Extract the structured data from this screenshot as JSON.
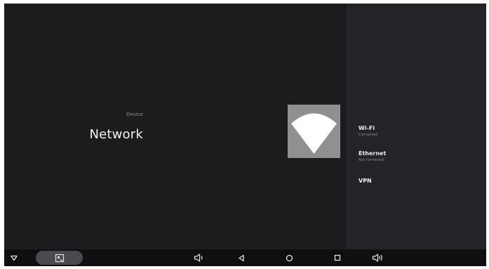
{
  "header": {
    "breadcrumb": "Device",
    "title": "Network"
  },
  "hero": {
    "icon": "wifi-signal-icon",
    "tile_color": "#8f9092"
  },
  "menu": {
    "items": [
      {
        "title": "Wi-Fi",
        "subtitle": "Connected"
      },
      {
        "title": "Ethernet",
        "subtitle": "Not connected"
      },
      {
        "title": "VPN",
        "subtitle": ""
      }
    ]
  },
  "navbar": {
    "buttons": [
      {
        "name": "hide-bar",
        "icon": "chevron-down-triangle-icon"
      },
      {
        "name": "screenshot",
        "icon": "screenshot-icon"
      },
      {
        "name": "volume-down",
        "icon": "volume-down-icon"
      },
      {
        "name": "back",
        "icon": "back-triangle-icon"
      },
      {
        "name": "home",
        "icon": "home-circle-icon"
      },
      {
        "name": "recents",
        "icon": "recents-square-icon"
      },
      {
        "name": "volume-up",
        "icon": "volume-up-icon"
      }
    ]
  },
  "colors": {
    "background": "#1b1c1e",
    "side_panel": "#222427",
    "navbar": "#0e0f10",
    "text_primary": "#f2f2f2",
    "text_secondary": "#8e8f92"
  }
}
